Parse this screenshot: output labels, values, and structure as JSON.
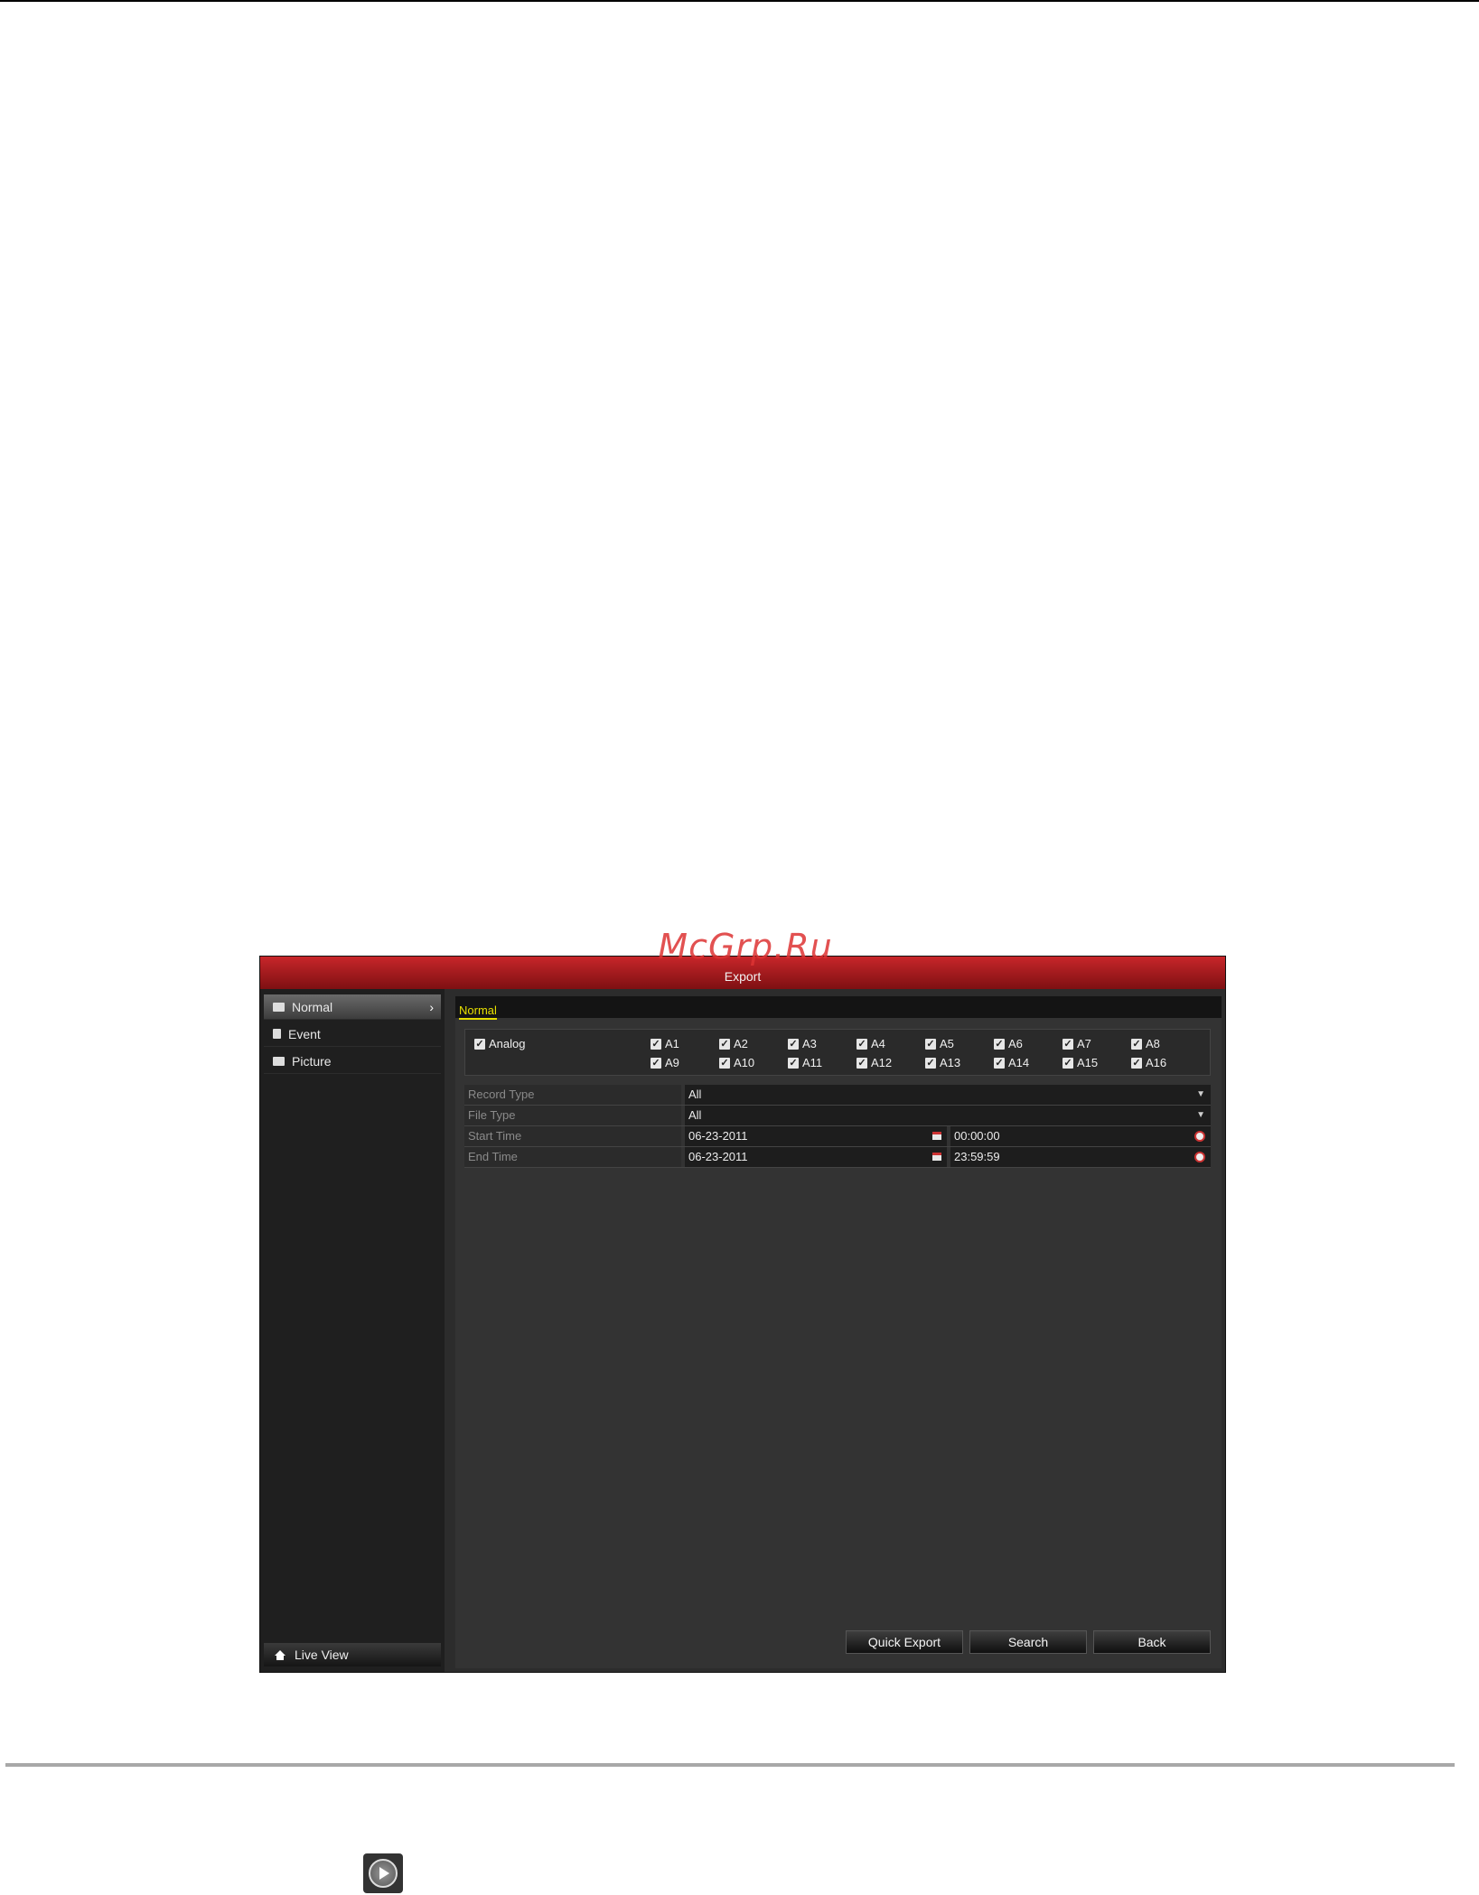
{
  "watermark": "McGrp.Ru",
  "window": {
    "title": "Export"
  },
  "sidebar": {
    "items": [
      {
        "label": "Normal",
        "icon": "folder-icon",
        "active": true
      },
      {
        "label": "Event",
        "icon": "event-icon",
        "active": false
      },
      {
        "label": "Picture",
        "icon": "picture-icon",
        "active": false
      }
    ],
    "live_view": "Live View"
  },
  "tabs": [
    {
      "label": "Normal",
      "active": true
    }
  ],
  "channels": {
    "group_label": "Analog",
    "group_checked": true,
    "list": [
      {
        "label": "A1",
        "checked": true
      },
      {
        "label": "A2",
        "checked": true
      },
      {
        "label": "A3",
        "checked": true
      },
      {
        "label": "A4",
        "checked": true
      },
      {
        "label": "A5",
        "checked": true
      },
      {
        "label": "A6",
        "checked": true
      },
      {
        "label": "A7",
        "checked": true
      },
      {
        "label": "A8",
        "checked": true
      },
      {
        "label": "A9",
        "checked": true
      },
      {
        "label": "A10",
        "checked": true
      },
      {
        "label": "A11",
        "checked": true
      },
      {
        "label": "A12",
        "checked": true
      },
      {
        "label": "A13",
        "checked": true
      },
      {
        "label": "A14",
        "checked": true
      },
      {
        "label": "A15",
        "checked": true
      },
      {
        "label": "A16",
        "checked": true
      }
    ]
  },
  "form": {
    "record_type": {
      "label": "Record Type",
      "value": "All"
    },
    "file_type": {
      "label": "File Type",
      "value": "All"
    },
    "start_time": {
      "label": "Start Time",
      "date": "06-23-2011",
      "time": "00:00:00"
    },
    "end_time": {
      "label": "End Time",
      "date": "06-23-2011",
      "time": "23:59:59"
    }
  },
  "buttons": {
    "quick_export": "Quick Export",
    "search": "Search",
    "back": "Back"
  },
  "colors": {
    "title_bar": "#b01c1f",
    "tab_accent": "#e8e000",
    "panel": "#333333"
  }
}
